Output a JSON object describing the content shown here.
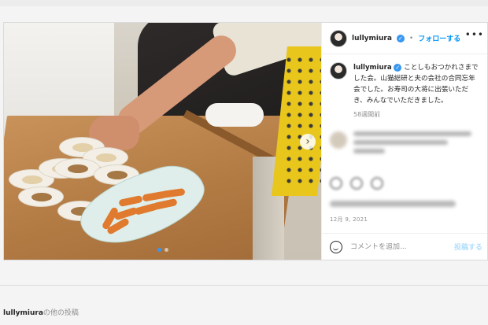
{
  "post": {
    "username": "lullymiura",
    "header_separator": "•",
    "follow_label": "フォローする",
    "more_label": "•••",
    "caption_text": "ことしもおつかれさまでした会。山猫総研と夫の会社の合同忘年会でした。お寿司の大将に出張いただき、みんなでいただきました。",
    "time_ago": "58週間前",
    "date": "12月 9, 2021",
    "comment_placeholder": "コメントを追加...",
    "post_button": "投稿する",
    "carousel_next": "›",
    "verified_mark": "✓"
  },
  "more_posts": {
    "username": "lullymiura",
    "suffix": "の他の投稿"
  },
  "colors": {
    "accent_blue": "#0095f6",
    "post_disabled": "#b2dffc"
  }
}
